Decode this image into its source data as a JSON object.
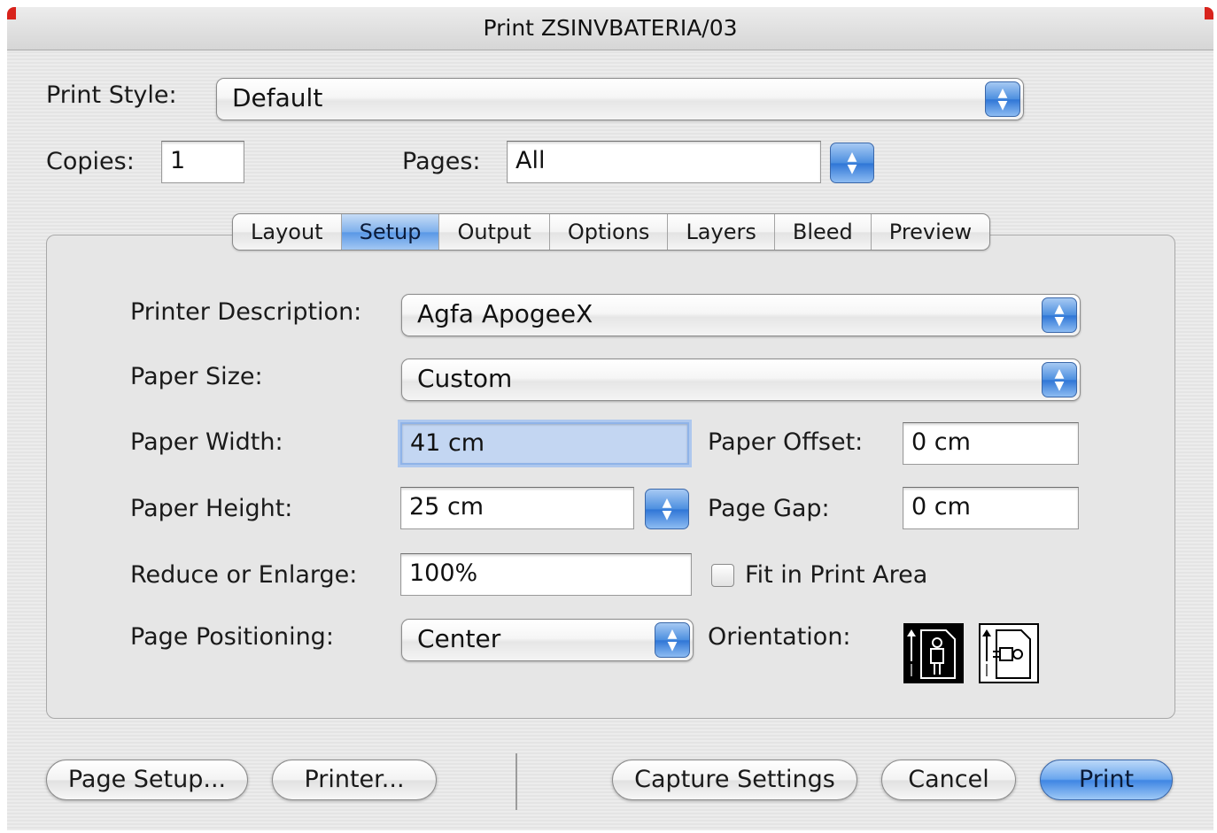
{
  "window": {
    "title": "Print ZSINVBATERIA/03"
  },
  "print_style": {
    "label": "Print Style:",
    "value": "Default"
  },
  "copies": {
    "label": "Copies:",
    "value": "1"
  },
  "pages": {
    "label": "Pages:",
    "value": "All"
  },
  "tabs": [
    {
      "label": "Layout",
      "active": false
    },
    {
      "label": "Setup",
      "active": true
    },
    {
      "label": "Output",
      "active": false
    },
    {
      "label": "Options",
      "active": false
    },
    {
      "label": "Layers",
      "active": false
    },
    {
      "label": "Bleed",
      "active": false
    },
    {
      "label": "Preview",
      "active": false
    }
  ],
  "setup": {
    "printer_description": {
      "label": "Printer Description:",
      "value": "Agfa ApogeeX"
    },
    "paper_size": {
      "label": "Paper Size:",
      "value": "Custom"
    },
    "paper_width": {
      "label": "Paper Width:",
      "value": "41 cm"
    },
    "paper_offset": {
      "label": "Paper Offset:",
      "value": "0 cm"
    },
    "paper_height": {
      "label": "Paper Height:",
      "value": "25 cm"
    },
    "page_gap": {
      "label": "Page Gap:",
      "value": "0 cm"
    },
    "reduce_enlarge": {
      "label": "Reduce or Enlarge:",
      "value": "100%"
    },
    "fit_in_print_area": {
      "label": "Fit in Print Area",
      "checked": false
    },
    "page_positioning": {
      "label": "Page Positioning:",
      "value": "Center"
    },
    "orientation": {
      "label": "Orientation:",
      "selected": "portrait",
      "icons": [
        "portrait-icon",
        "landscape-icon"
      ]
    }
  },
  "buttons": {
    "page_setup": "Page Setup...",
    "printer": "Printer...",
    "capture_settings": "Capture Settings",
    "cancel": "Cancel",
    "print": "Print"
  },
  "colors": {
    "accent": "#3f86e3",
    "focus": "#aec8ee",
    "close_corner": "#d8231c"
  }
}
